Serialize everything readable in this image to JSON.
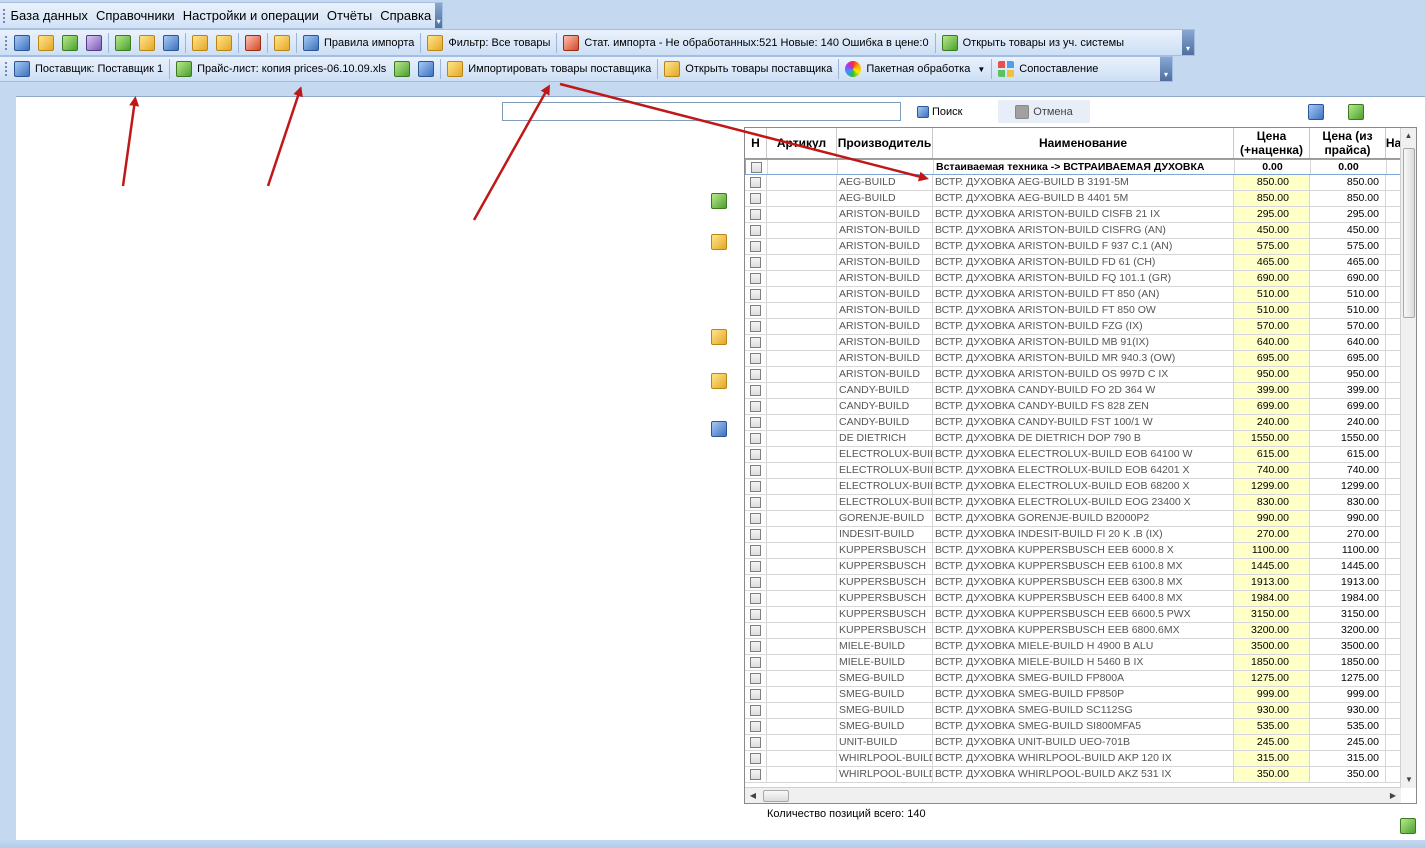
{
  "menu": {
    "items": [
      {
        "key": "db",
        "label": "База данных"
      },
      {
        "key": "refs",
        "label": "Справочники"
      },
      {
        "key": "settings",
        "label": "Настройки и операции"
      },
      {
        "key": "reports",
        "label": "Отчёты"
      },
      {
        "key": "help",
        "label": "Справка"
      }
    ]
  },
  "toolbar": {
    "import_rules": "Правила импорта",
    "filter": "Фильтр: Все товары",
    "import_stats": "Стат. импорта - Не обработанных:521  Новые: 140  Ошибка в цене:0",
    "open_accounting": "Открыть товары из уч. системы"
  },
  "supplier_bar": {
    "supplier": "Поставщик: Поставщик 1",
    "pricelist": "Прайс-лист: копия prices-06.10.09.xls",
    "import_goods": "Импортировать товары поставщика",
    "open_supplier_goods": "Открыть товары поставщика",
    "batch": "Пакетная обработка",
    "compare": "Сопоставление"
  },
  "search": {
    "value": "",
    "search_label": "Поиск",
    "cancel_label": "Отмена"
  },
  "grid": {
    "columns": {
      "n": "Н",
      "article": "Артикул",
      "manufacturer": "Производитель",
      "name": "Наименование",
      "price_markup": "Цена (+наценка)",
      "price_list": "Цена (из прайса)",
      "extra": "На"
    },
    "group": {
      "name": "Встаиваемая техника -> ВСТРАИВАЕМАЯ ДУХОВКА",
      "price_markup": "0.00",
      "price_list": "0.00"
    },
    "rows": [
      {
        "m": "AEG-BUILD",
        "n": "ВСТР. ДУХОВКА AEG-BUILD B 3191-5M",
        "p1": "850.00",
        "p2": "850.00"
      },
      {
        "m": "AEG-BUILD",
        "n": "ВСТР. ДУХОВКА AEG-BUILD B 4401 5M",
        "p1": "850.00",
        "p2": "850.00"
      },
      {
        "m": "ARISTON-BUILD",
        "n": "ВСТР. ДУХОВКА ARISTON-BUILD CISFB 21 IX",
        "p1": "295.00",
        "p2": "295.00"
      },
      {
        "m": "ARISTON-BUILD",
        "n": "ВСТР. ДУХОВКА ARISTON-BUILD CISFRG (AN)",
        "p1": "450.00",
        "p2": "450.00"
      },
      {
        "m": "ARISTON-BUILD",
        "n": "ВСТР. ДУХОВКА ARISTON-BUILD F 937 C.1 (AN)",
        "p1": "575.00",
        "p2": "575.00"
      },
      {
        "m": "ARISTON-BUILD",
        "n": "ВСТР. ДУХОВКА ARISTON-BUILD FD 61 (CH)",
        "p1": "465.00",
        "p2": "465.00"
      },
      {
        "m": "ARISTON-BUILD",
        "n": "ВСТР. ДУХОВКА ARISTON-BUILD FQ 101.1 (GR)",
        "p1": "690.00",
        "p2": "690.00"
      },
      {
        "m": "ARISTON-BUILD",
        "n": "ВСТР. ДУХОВКА ARISTON-BUILD FT 850 (AN)",
        "p1": "510.00",
        "p2": "510.00"
      },
      {
        "m": "ARISTON-BUILD",
        "n": "ВСТР. ДУХОВКА ARISTON-BUILD FT 850 OW",
        "p1": "510.00",
        "p2": "510.00"
      },
      {
        "m": "ARISTON-BUILD",
        "n": "ВСТР. ДУХОВКА ARISTON-BUILD FZG (IX)",
        "p1": "570.00",
        "p2": "570.00"
      },
      {
        "m": "ARISTON-BUILD",
        "n": "ВСТР. ДУХОВКА ARISTON-BUILD MB 91(IX)",
        "p1": "640.00",
        "p2": "640.00"
      },
      {
        "m": "ARISTON-BUILD",
        "n": "ВСТР. ДУХОВКА ARISTON-BUILD MR 940.3 (OW)",
        "p1": "695.00",
        "p2": "695.00"
      },
      {
        "m": "ARISTON-BUILD",
        "n": "ВСТР. ДУХОВКА ARISTON-BUILD OS 997D C IX",
        "p1": "950.00",
        "p2": "950.00"
      },
      {
        "m": "CANDY-BUILD",
        "n": "ВСТР. ДУХОВКА CANDY-BUILD FO 2D 364 W",
        "p1": "399.00",
        "p2": "399.00"
      },
      {
        "m": "CANDY-BUILD",
        "n": "ВСТР. ДУХОВКА CANDY-BUILD FS 828 ZEN",
        "p1": "699.00",
        "p2": "699.00"
      },
      {
        "m": "CANDY-BUILD",
        "n": "ВСТР. ДУХОВКА CANDY-BUILD FST 100/1 W",
        "p1": "240.00",
        "p2": "240.00"
      },
      {
        "m": "DE DIETRICH",
        "n": "ВСТР. ДУХОВКА DE DIETRICH DOP 790 B",
        "p1": "1550.00",
        "p2": "1550.00"
      },
      {
        "m": "ELECTROLUX-BUILD",
        "n": "ВСТР. ДУХОВКА ELECTROLUX-BUILD EOB 64100 W",
        "p1": "615.00",
        "p2": "615.00"
      },
      {
        "m": "ELECTROLUX-BUILD",
        "n": "ВСТР. ДУХОВКА ELECTROLUX-BUILD EOB 64201 X",
        "p1": "740.00",
        "p2": "740.00"
      },
      {
        "m": "ELECTROLUX-BUILD",
        "n": "ВСТР. ДУХОВКА ELECTROLUX-BUILD EOB 68200 X",
        "p1": "1299.00",
        "p2": "1299.00"
      },
      {
        "m": "ELECTROLUX-BUILD",
        "n": "ВСТР. ДУХОВКА ELECTROLUX-BUILD EOG 23400 X",
        "p1": "830.00",
        "p2": "830.00"
      },
      {
        "m": "GORENJE-BUILD",
        "n": "ВСТР. ДУХОВКА GORENJE-BUILD B2000P2",
        "p1": "990.00",
        "p2": "990.00"
      },
      {
        "m": "INDESIT-BUILD",
        "n": "ВСТР. ДУХОВКА INDESIT-BUILD FI 20 K .B (IX)",
        "p1": "270.00",
        "p2": "270.00"
      },
      {
        "m": "KUPPERSBUSCH",
        "n": "ВСТР. ДУХОВКА KUPPERSBUSCH EEB 6000.8 X",
        "p1": "1100.00",
        "p2": "1100.00"
      },
      {
        "m": "KUPPERSBUSCH",
        "n": "ВСТР. ДУХОВКА KUPPERSBUSCH EEB 6100.8 MX",
        "p1": "1445.00",
        "p2": "1445.00"
      },
      {
        "m": "KUPPERSBUSCH",
        "n": "ВСТР. ДУХОВКА KUPPERSBUSCH EEB 6300.8 MX",
        "p1": "1913.00",
        "p2": "1913.00"
      },
      {
        "m": "KUPPERSBUSCH",
        "n": "ВСТР. ДУХОВКА KUPPERSBUSCH EEB 6400.8 MX",
        "p1": "1984.00",
        "p2": "1984.00"
      },
      {
        "m": "KUPPERSBUSCH",
        "n": "ВСТР. ДУХОВКА KUPPERSBUSCH EEB 6600.5 PWX",
        "p1": "3150.00",
        "p2": "3150.00"
      },
      {
        "m": "KUPPERSBUSCH",
        "n": "ВСТР. ДУХОВКА KUPPERSBUSCH EEB 6800.6MX",
        "p1": "3200.00",
        "p2": "3200.00"
      },
      {
        "m": "MIELE-BUILD",
        "n": "ВСТР. ДУХОВКА MIELE-BUILD H 4900 B ALU",
        "p1": "3500.00",
        "p2": "3500.00"
      },
      {
        "m": "MIELE-BUILD",
        "n": "ВСТР. ДУХОВКА MIELE-BUILD H 5460 B IX",
        "p1": "1850.00",
        "p2": "1850.00"
      },
      {
        "m": "SMEG-BUILD",
        "n": "ВСТР. ДУХОВКА SMEG-BUILD FP800A",
        "p1": "1275.00",
        "p2": "1275.00"
      },
      {
        "m": "SMEG-BUILD",
        "n": "ВСТР. ДУХОВКА SMEG-BUILD FP850P",
        "p1": "999.00",
        "p2": "999.00"
      },
      {
        "m": "SMEG-BUILD",
        "n": "ВСТР. ДУХОВКА SMEG-BUILD SC112SG",
        "p1": "930.00",
        "p2": "930.00"
      },
      {
        "m": "SMEG-BUILD",
        "n": "ВСТР. ДУХОВКА SMEG-BUILD SI800MFA5",
        "p1": "535.00",
        "p2": "535.00"
      },
      {
        "m": "UNIT-BUILD",
        "n": "ВСТР. ДУХОВКА UNIT-BUILD UEO-701B",
        "p1": "245.00",
        "p2": "245.00"
      },
      {
        "m": "WHIRLPOOL-BUILD",
        "n": "ВСТР. ДУХОВКА WHIRLPOOL-BUILD AKP 120 IX",
        "p1": "315.00",
        "p2": "315.00"
      },
      {
        "m": "WHIRLPOOL-BUILD",
        "n": "ВСТР. ДУХОВКА WHIRLPOOL-BUILD AKZ 531 IX",
        "p1": "350.00",
        "p2": "350.00"
      }
    ]
  },
  "footer": {
    "count": "Количество позиций всего: 140"
  },
  "colors": {
    "toolbar_bg": "#d2e2f6",
    "markup_cell": "#ffffc8",
    "annotation_arrow": "#c01818"
  }
}
